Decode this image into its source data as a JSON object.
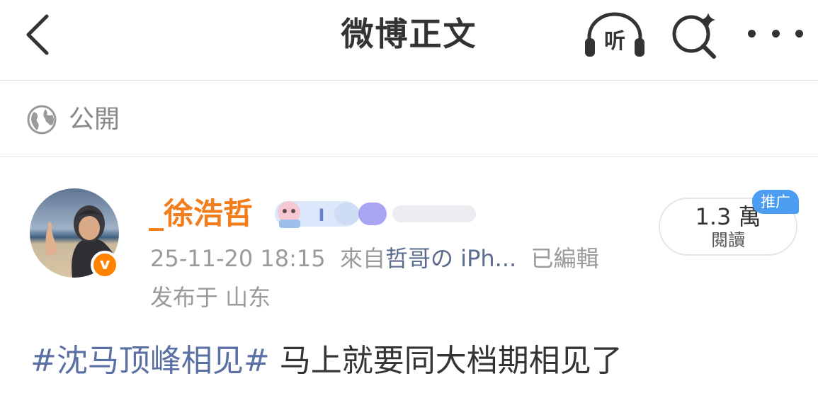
{
  "nav": {
    "title": "微博正文",
    "listen_label": "听"
  },
  "visibility": {
    "label": "公開"
  },
  "author": {
    "name": "_徐浩哲",
    "verified_badge": "v"
  },
  "meta": {
    "timestamp": "25-11-20 18:15",
    "source_prefix": "來自",
    "device": "哲哥の iPh...",
    "edited": "已編輯",
    "location": "发布于 山东"
  },
  "reads": {
    "count": "1.3 萬",
    "label": "閱讀",
    "promo_tag": "推广"
  },
  "post": {
    "topic": "#沈马顶峰相见#",
    "text": " 马上就要同大档期相见了"
  },
  "colors": {
    "username": "#f37d1b",
    "topic_link": "#5a6fa3",
    "verified_badge": "#ff8200",
    "promo_tag": "#4a9df0"
  }
}
